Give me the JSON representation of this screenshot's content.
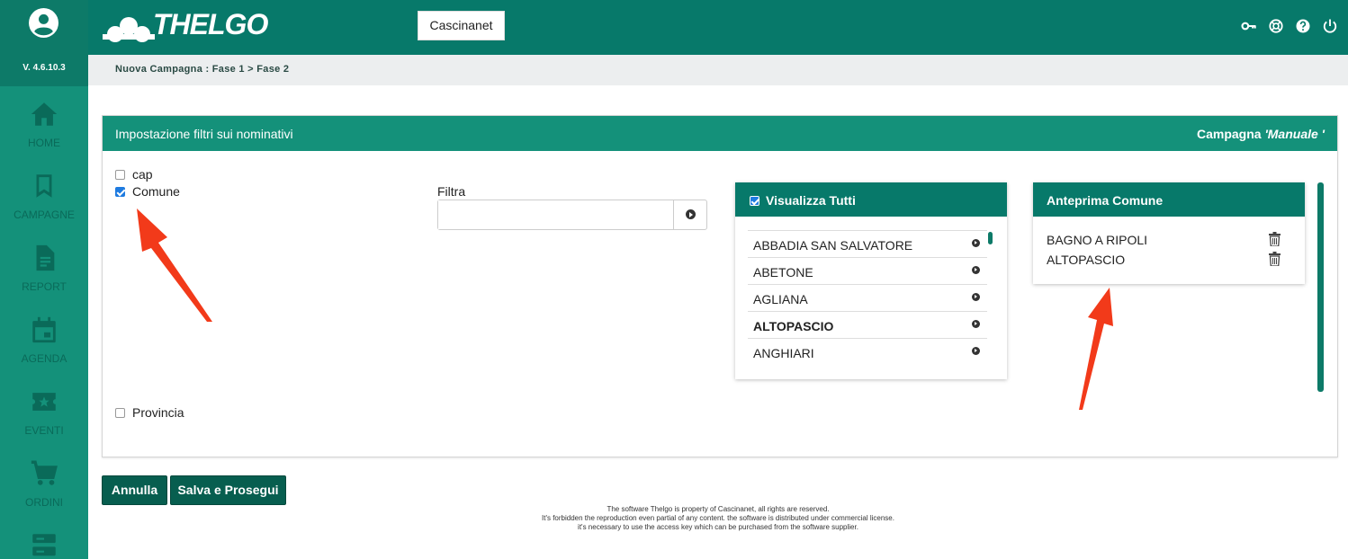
{
  "app": {
    "logo_text": "THELGO",
    "version": "V. 4.6.10.3",
    "company_button": "Cascinanet",
    "accent": "#07796a",
    "sidebar_color": "#14917a"
  },
  "sidebar": {
    "items": [
      {
        "label": "HOME",
        "icon": "home-icon"
      },
      {
        "label": "CAMPAGNE",
        "icon": "bookmark-icon"
      },
      {
        "label": "REPORT",
        "icon": "document-icon"
      },
      {
        "label": "AGENDA",
        "icon": "calendar-icon"
      },
      {
        "label": "EVENTI",
        "icon": "ticket-icon"
      },
      {
        "label": "ORDINI",
        "icon": "cart-icon"
      },
      {
        "label": "",
        "icon": "server-icon"
      }
    ]
  },
  "header": {
    "icons": [
      "key-icon",
      "support-icon",
      "help-icon",
      "power-icon"
    ]
  },
  "breadcrumb": "Nuova Campagna : Fase 1 > Fase 2",
  "panel": {
    "title": "Impostazione filtri sui nominativi",
    "campaign_prefix": "Campagna ",
    "campaign_name": "'Manuale '",
    "filters": [
      {
        "label": "cap",
        "checked": false
      },
      {
        "label": "Comune",
        "checked": true
      },
      {
        "label": "Provincia",
        "checked": false
      }
    ],
    "filtra_label": "Filtra",
    "filtra_value": "",
    "lista": {
      "header": "Visualizza Tutti",
      "items": [
        {
          "label": "ABBADIA SAN SALVATORE",
          "bold": false
        },
        {
          "label": "ABETONE",
          "bold": false
        },
        {
          "label": "AGLIANA",
          "bold": false
        },
        {
          "label": "ALTOPASCIO",
          "bold": true
        },
        {
          "label": "ANGHIARI",
          "bold": false
        }
      ]
    },
    "anteprima": {
      "header": "Anteprima Comune",
      "items": [
        "BAGNO A RIPOLI",
        "ALTOPASCIO"
      ]
    }
  },
  "buttons": {
    "annulla": "Annulla",
    "salva": "Salva e Prosegui"
  },
  "footer": {
    "line1": "The software Thelgo is property of Cascinanet, all rights are reserved.",
    "line2": "It's forbidden the reproduction even partial of any content. the software is distributed under commercial license.",
    "line3": "it's necessary to use the access key which can be purchased from the software supplier."
  }
}
